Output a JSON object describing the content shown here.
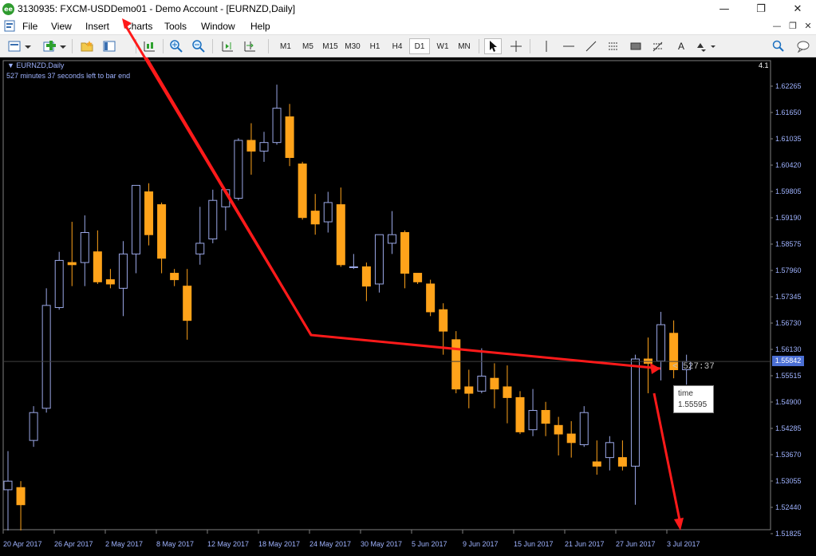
{
  "window": {
    "title": "3130935: FXCM-USDDemo01 - Demo Account - [EURNZD,Daily]",
    "app_icon_text": "ee",
    "controls": {
      "minimize": "—",
      "restore": "❐",
      "close": "✕"
    }
  },
  "menu": {
    "items": [
      "File",
      "View",
      "Insert",
      "Charts",
      "Tools",
      "Window",
      "Help"
    ],
    "mdi_controls": [
      "—",
      "❐",
      "✕"
    ]
  },
  "toolbar": {
    "timeframes": [
      "M1",
      "M5",
      "M15",
      "M30",
      "H1",
      "H4",
      "D1",
      "W1",
      "MN"
    ],
    "active_timeframe": "D1",
    "text_tool": "A",
    "icons": [
      "new-chart-icon",
      "add-icon",
      "favorites-icon",
      "navigator-icon",
      "autotrading-icon",
      "chart-shift-icon",
      "zoom-in-icon",
      "zoom-out-icon",
      "cursor-icon",
      "crosshair-icon",
      "horizontal-line-icon",
      "trendline-icon",
      "channel-icon",
      "rectangle-icon",
      "fibonacci-icon",
      "text-icon",
      "arrows-icon",
      "search-icon",
      "chat-icon"
    ]
  },
  "chart": {
    "symbol_label": "EURNZD,Daily",
    "bar_end_text": "527 minutes 37 seconds left to bar end",
    "one_click_label": "4.1",
    "countdown": "< 527:37",
    "current_price": "1.55842",
    "tooltip": {
      "label": "time",
      "value": "1.55595"
    },
    "price_axis": [
      "1.62265",
      "1.61650",
      "1.61035",
      "1.60420",
      "1.59805",
      "1.59190",
      "1.58575",
      "1.57960",
      "1.57345",
      "1.56730",
      "1.56130",
      "1.55515",
      "1.54900",
      "1.54285",
      "1.53670",
      "1.53055",
      "1.52440",
      "1.51825"
    ],
    "time_axis": [
      "20 Apr 2017",
      "26 Apr 2017",
      "2 May 2017",
      "8 May 2017",
      "12 May 2017",
      "18 May 2017",
      "24 May 2017",
      "30 May 2017",
      "5 Jun 2017",
      "9 Jun 2017",
      "15 Jun 2017",
      "21 Jun 2017",
      "27 Jun 2017",
      "3 Jul 2017"
    ],
    "colors": {
      "background": "#000000",
      "bull": "#9aa7e6",
      "bear": "#ffa31a",
      "axis": "#9fb3ff",
      "annotation": "#ff1a1a",
      "grid_line": "#404040"
    }
  },
  "chart_data": {
    "type": "candlestick",
    "title": "",
    "ylim": [
      1.518,
      1.627
    ],
    "candles": [
      {
        "o": 1.5285,
        "h": 1.5375,
        "l": 1.519,
        "c": 1.5305
      },
      {
        "o": 1.529,
        "h": 1.5305,
        "l": 1.519,
        "c": 1.525
      },
      {
        "o": 1.54,
        "h": 1.548,
        "l": 1.5385,
        "c": 1.5465
      },
      {
        "o": 1.5475,
        "h": 1.5755,
        "l": 1.5465,
        "c": 1.5715
      },
      {
        "o": 1.571,
        "h": 1.584,
        "l": 1.5705,
        "c": 1.582
      },
      {
        "o": 1.5815,
        "h": 1.591,
        "l": 1.576,
        "c": 1.581
      },
      {
        "o": 1.5815,
        "h": 1.5925,
        "l": 1.576,
        "c": 1.5885
      },
      {
        "o": 1.584,
        "h": 1.589,
        "l": 1.5765,
        "c": 1.577
      },
      {
        "o": 1.5775,
        "h": 1.58,
        "l": 1.5755,
        "c": 1.5765
      },
      {
        "o": 1.5755,
        "h": 1.5865,
        "l": 1.569,
        "c": 1.5835
      },
      {
        "o": 1.5835,
        "h": 1.5985,
        "l": 1.579,
        "c": 1.5995
      },
      {
        "o": 1.598,
        "h": 1.6,
        "l": 1.5855,
        "c": 1.588
      },
      {
        "o": 1.595,
        "h": 1.5955,
        "l": 1.579,
        "c": 1.5825
      },
      {
        "o": 1.579,
        "h": 1.58,
        "l": 1.576,
        "c": 1.5775
      },
      {
        "o": 1.576,
        "h": 1.58,
        "l": 1.5635,
        "c": 1.568
      },
      {
        "o": 1.5835,
        "h": 1.5945,
        "l": 1.581,
        "c": 1.586
      },
      {
        "o": 1.587,
        "h": 1.5985,
        "l": 1.586,
        "c": 1.596
      },
      {
        "o": 1.5945,
        "h": 1.5985,
        "l": 1.589,
        "c": 1.5985
      },
      {
        "o": 1.5965,
        "h": 1.6105,
        "l": 1.596,
        "c": 1.61
      },
      {
        "o": 1.61,
        "h": 1.614,
        "l": 1.602,
        "c": 1.6075
      },
      {
        "o": 1.6075,
        "h": 1.612,
        "l": 1.605,
        "c": 1.6095
      },
      {
        "o": 1.6095,
        "h": 1.623,
        "l": 1.609,
        "c": 1.6175
      },
      {
        "o": 1.6155,
        "h": 1.6185,
        "l": 1.604,
        "c": 1.606
      },
      {
        "o": 1.6045,
        "h": 1.605,
        "l": 1.5915,
        "c": 1.592
      },
      {
        "o": 1.5935,
        "h": 1.5975,
        "l": 1.588,
        "c": 1.5905
      },
      {
        "o": 1.591,
        "h": 1.598,
        "l": 1.5885,
        "c": 1.5955
      },
      {
        "o": 1.595,
        "h": 1.599,
        "l": 1.5805,
        "c": 1.581
      },
      {
        "o": 1.5805,
        "h": 1.5835,
        "l": 1.58,
        "c": 1.5805
      },
      {
        "o": 1.5805,
        "h": 1.5815,
        "l": 1.5725,
        "c": 1.576
      },
      {
        "o": 1.5765,
        "h": 1.588,
        "l": 1.5745,
        "c": 1.588
      },
      {
        "o": 1.586,
        "h": 1.5935,
        "l": 1.5835,
        "c": 1.588
      },
      {
        "o": 1.5885,
        "h": 1.589,
        "l": 1.5755,
        "c": 1.579
      },
      {
        "o": 1.579,
        "h": 1.579,
        "l": 1.5765,
        "c": 1.577
      },
      {
        "o": 1.5765,
        "h": 1.5775,
        "l": 1.569,
        "c": 1.57
      },
      {
        "o": 1.5705,
        "h": 1.572,
        "l": 1.56,
        "c": 1.5655
      },
      {
        "o": 1.5635,
        "h": 1.5655,
        "l": 1.551,
        "c": 1.552
      },
      {
        "o": 1.5525,
        "h": 1.5565,
        "l": 1.5475,
        "c": 1.551
      },
      {
        "o": 1.5515,
        "h": 1.5615,
        "l": 1.551,
        "c": 1.555
      },
      {
        "o": 1.5545,
        "h": 1.558,
        "l": 1.5475,
        "c": 1.552
      },
      {
        "o": 1.5525,
        "h": 1.5575,
        "l": 1.544,
        "c": 1.55
      },
      {
        "o": 1.55,
        "h": 1.5515,
        "l": 1.5415,
        "c": 1.542
      },
      {
        "o": 1.5425,
        "h": 1.552,
        "l": 1.541,
        "c": 1.547
      },
      {
        "o": 1.547,
        "h": 1.549,
        "l": 1.541,
        "c": 1.544
      },
      {
        "o": 1.5435,
        "h": 1.5455,
        "l": 1.5365,
        "c": 1.5415
      },
      {
        "o": 1.5415,
        "h": 1.5445,
        "l": 1.536,
        "c": 1.5395
      },
      {
        "o": 1.539,
        "h": 1.548,
        "l": 1.5385,
        "c": 1.5465
      },
      {
        "o": 1.535,
        "h": 1.54,
        "l": 1.532,
        "c": 1.534
      },
      {
        "o": 1.536,
        "h": 1.541,
        "l": 1.533,
        "c": 1.5395
      },
      {
        "o": 1.536,
        "h": 1.54,
        "l": 1.533,
        "c": 1.534
      },
      {
        "o": 1.534,
        "h": 1.56,
        "l": 1.525,
        "c": 1.559
      },
      {
        "o": 1.559,
        "h": 1.564,
        "l": 1.551,
        "c": 1.558
      },
      {
        "o": 1.5585,
        "h": 1.57,
        "l": 1.554,
        "c": 1.567
      },
      {
        "o": 1.565,
        "h": 1.568,
        "l": 1.5545,
        "c": 1.5565
      },
      {
        "o": 1.5565,
        "h": 1.56,
        "l": 1.553,
        "c": 1.5584
      }
    ]
  }
}
